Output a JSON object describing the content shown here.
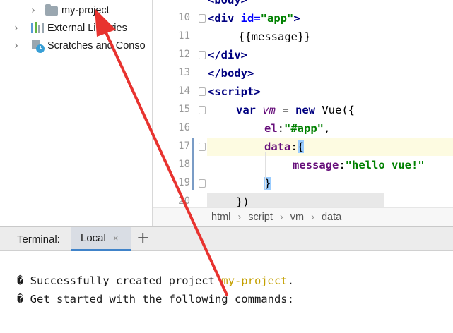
{
  "project_tree": {
    "items": [
      {
        "label": "my-project",
        "icon": "folder-icon"
      },
      {
        "label": "External Libraries",
        "icon": "library-icon"
      },
      {
        "label": "Scratches and Conso",
        "icon": "scratches-icon"
      }
    ]
  },
  "editor": {
    "line_numbers": [
      "10",
      "11",
      "12",
      "13",
      "14",
      "15",
      "16",
      "17",
      "18",
      "19",
      "20"
    ],
    "top_partial_line": "<body>",
    "lines": {
      "l10": {
        "open": "<div ",
        "attr": "id=",
        "val": "\"app\"",
        "close": ">"
      },
      "l11": "{{message}}",
      "l12": "</div>",
      "l13": "</body>",
      "l14": "<script>",
      "l15": {
        "kw1": "var ",
        "var": "vm",
        "mid": " = ",
        "kw2": "new ",
        "rest": "Vue({"
      },
      "l16": {
        "prop": "el",
        "colon": ":",
        "str": "\"#app\"",
        "comma": ","
      },
      "l17": {
        "prop": "data",
        "colon": ":",
        "brace": "{"
      },
      "l18": {
        "prop": "message",
        "colon": ":",
        "str": "\"hello vue!\""
      },
      "l19": {
        "brace": "}"
      },
      "l20": "})"
    }
  },
  "breadcrumb": {
    "items": [
      "html",
      "script",
      "vm",
      "data"
    ]
  },
  "terminal": {
    "title": "Terminal:",
    "tab_label": "Local",
    "close_glyph": "×",
    "add_glyph": "+",
    "lines": {
      "line1_prefix": "� Successfully created project ",
      "line1_project": "my-project",
      "line1_suffix": ".",
      "line2": "� Get started with the following commands:"
    }
  },
  "colors": {
    "annotation_arrow": "#e8332f",
    "tab_underline": "#4083c9",
    "current_line_bg": "#fdfbe1"
  }
}
